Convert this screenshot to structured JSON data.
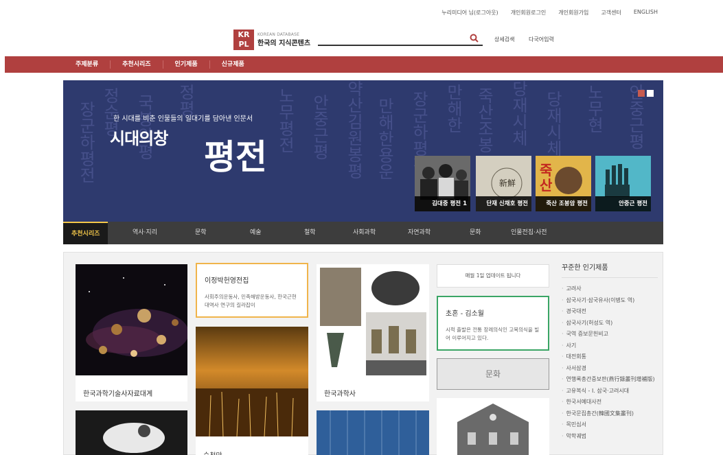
{
  "header": {
    "top_links": [
      "누리미디어 님(로그아웃)",
      "개인회원로그인",
      "개인회원가입",
      "고객센터",
      "ENGLISH"
    ],
    "logo_mark": "KR PL",
    "logo_sub": "KOREAN DATABASE",
    "logo_main": "한국의 지식콘텐츠",
    "search_placeholder": "",
    "advanced_search": "상세검색",
    "multi_input": "다국어입력"
  },
  "nav": {
    "items": [
      "주제분류",
      "추천시리즈",
      "인기제품",
      "신규제품"
    ]
  },
  "hero": {
    "subtitle": "한 시대를 비춘 인물들의 일대기를 담아낸 인문서",
    "brand": "시대의창",
    "title": "평전",
    "thumbs": [
      {
        "caption": "김대중 평전 1",
        "color": "#444"
      },
      {
        "caption": "단재 신채호 평전",
        "color": "#c9c3b2"
      },
      {
        "caption": "죽산 조봉암 평전",
        "color": "#d9a33a"
      },
      {
        "caption": "안중근 평전",
        "color": "#4db0c4"
      }
    ],
    "dot_colors": [
      "#c65b4f",
      "#ffffff"
    ]
  },
  "categories": {
    "items": [
      "추천시리즈",
      "역사·지리",
      "문학",
      "예술",
      "철학",
      "사회과학",
      "자연과학",
      "문화",
      "인물전집·사전"
    ]
  },
  "cards": {
    "c1_title": "한국과학기술사자료대계",
    "c2_title": "이정박헌영전집",
    "c2_desc": "사회주의운동사, 민족해방운동사, 한국근현대역사 연구의 길라잡이",
    "c3_title": "순천만",
    "c4_title": "한국과학사",
    "c5_text": "매월 1일 업데이트 됩니다",
    "c6_title": "초혼 - 김소월",
    "c6_desc": "시적 출발은 전통 장례의식인 고복의식을 빌어 이루어지고 있다.",
    "c7_label": "문화"
  },
  "sidebar": {
    "title": "꾸준한 인기제품",
    "items": [
      "고려사",
      "삼국사기·삼국유사(이병도 역)",
      "경국대전",
      "삼국사기(허성도 역)",
      "국역 증보문헌비고",
      "사기",
      "대전회통",
      "사서삼경",
      "연행록총간증보판(燕行錄叢刊增補版)",
      "고유복식 - Ⅰ. 삼국·고려시대",
      "한국서예대사전",
      "한국문집총간(韓國文集叢刊)",
      "목민심서",
      "악학궤범"
    ]
  },
  "colors": {
    "brand_red": "#b0403f",
    "hero_blue": "#2e3a6e",
    "accent_yellow": "#f4c84a"
  }
}
